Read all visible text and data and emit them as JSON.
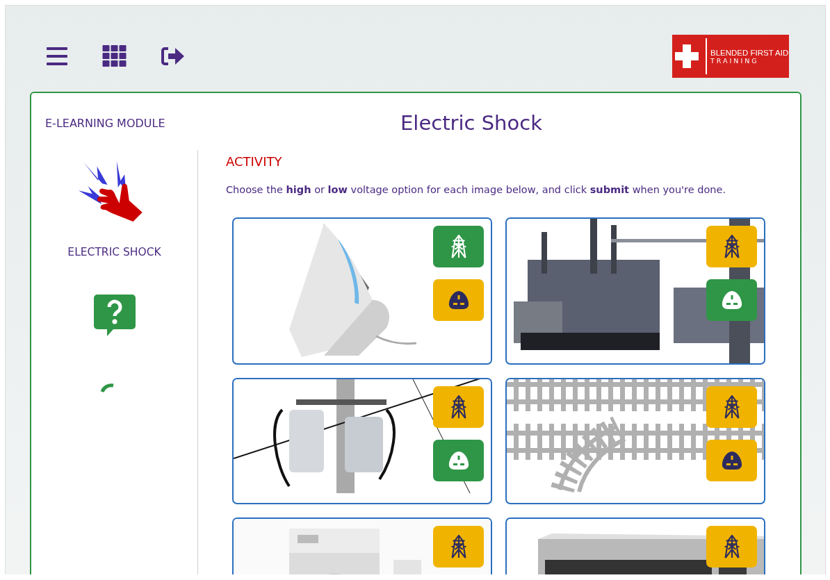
{
  "logo": {
    "line_1": "BLENDED FIRST AID",
    "line_2": "TRAINING"
  },
  "module_label": "E-LEARNING MODULE",
  "title": "Electric Shock",
  "topic": {
    "label": "ELECTRIC SHOCK"
  },
  "activity": {
    "heading": "ACTIVITY",
    "instructions": "Choose the **high** or **low** voltage option for each image below, and click **submit** when you're done."
  },
  "cards": [
    {
      "kind": "picture",
      "options": [
        {
          "kind": "high",
          "selected": true
        },
        {
          "kind": "low",
          "selected": false
        }
      ]
    },
    {
      "kind": "picture",
      "options": [
        {
          "kind": "high",
          "selected": false
        },
        {
          "kind": "low",
          "selected": true
        }
      ]
    },
    {
      "kind": "picture",
      "options": [
        {
          "kind": "high",
          "selected": false
        },
        {
          "kind": "low",
          "selected": true
        }
      ]
    },
    {
      "kind": "picture",
      "options": [
        {
          "kind": "high",
          "selected": false
        },
        {
          "kind": "low",
          "selected": false
        }
      ]
    },
    {
      "kind": "picture",
      "options": [
        {
          "kind": "high",
          "selected": false
        }
      ]
    },
    {
      "kind": "picture",
      "options": [
        {
          "kind": "high",
          "selected": false
        }
      ]
    }
  ]
}
